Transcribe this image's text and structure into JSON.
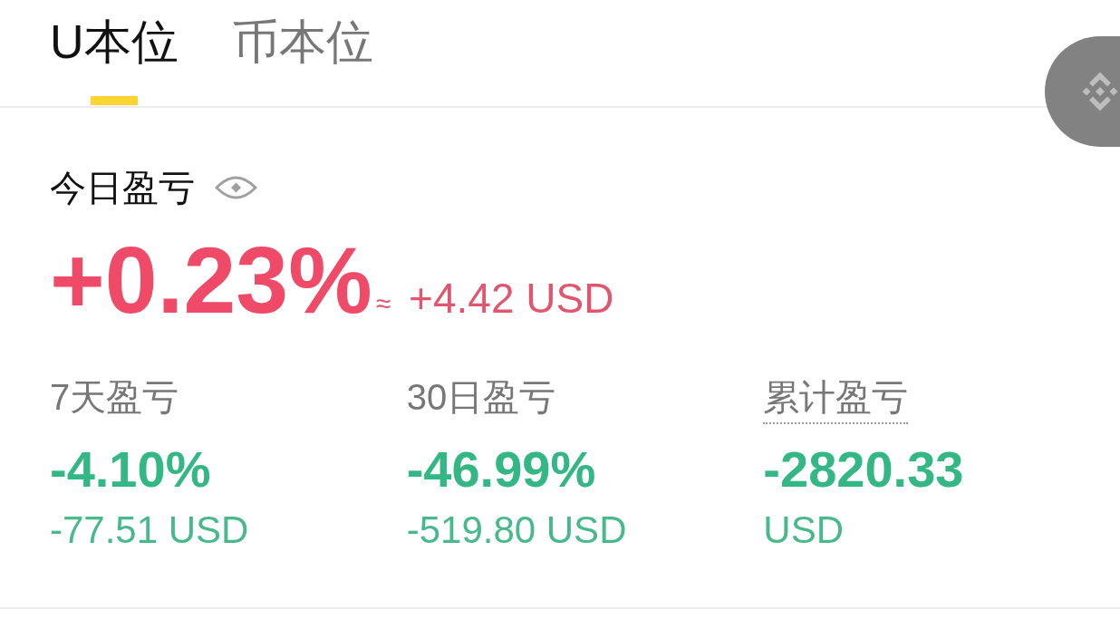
{
  "tabs": [
    {
      "label": "U本位",
      "selected": true
    },
    {
      "label": "币本位",
      "selected": false
    }
  ],
  "today_pnl": {
    "label": "今日盈亏",
    "percent": "+0.23%",
    "approx_sign": "≈",
    "amount": "+4.42 USD",
    "kind": "gain"
  },
  "periods": [
    {
      "label": "7天盈亏",
      "dotted_underline": false,
      "value": "-4.10%",
      "amount": "-77.51 USD",
      "kind": "loss"
    },
    {
      "label": "30日盈亏",
      "dotted_underline": false,
      "value": "-46.99%",
      "amount": "-519.80 USD",
      "kind": "loss"
    },
    {
      "label": "累计盈亏",
      "dotted_underline": true,
      "value": "-2820.33",
      "amount": "USD",
      "kind": "loss"
    }
  ]
}
